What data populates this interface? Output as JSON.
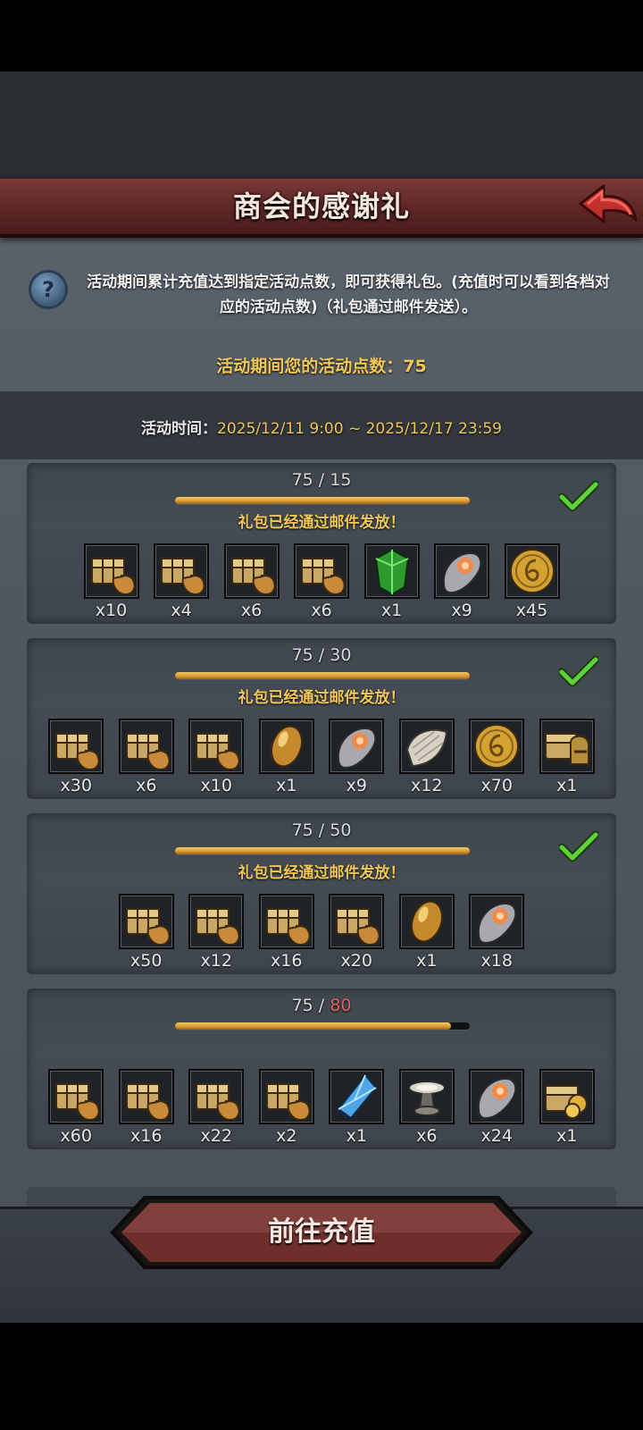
{
  "header": {
    "title": "商会的感谢礼"
  },
  "description": "活动期间累计充值达到指定活动点数，即可获得礼包。(充值时可以看到各档对应的活动点数)（礼包通过邮件发送）。",
  "points": {
    "text": "活动期间您的活动点数：75",
    "value": 75
  },
  "time": {
    "label": "活动时间：",
    "value": "2025/12/11 9:00 ~ 2025/12/17 23:59"
  },
  "tiers": [
    {
      "current": "75",
      "sep": " / ",
      "required": "15",
      "progress": 1.0,
      "claimed": true,
      "status": "礼包已经通过邮件发放！",
      "items": [
        {
          "icon": "chest-bag-icon",
          "qty": "x10"
        },
        {
          "icon": "chest-bag-icon",
          "qty": "x4"
        },
        {
          "icon": "chest-bag-icon",
          "qty": "x6"
        },
        {
          "icon": "chest-bag-icon",
          "qty": "x6"
        },
        {
          "icon": "green-crystal-icon",
          "qty": "x1"
        },
        {
          "icon": "stone-icon",
          "qty": "x9"
        },
        {
          "icon": "gold-coin-icon",
          "qty": "x45"
        }
      ]
    },
    {
      "current": "75",
      "sep": " / ",
      "required": "30",
      "progress": 1.0,
      "claimed": true,
      "status": "礼包已经通过邮件发放！",
      "items": [
        {
          "icon": "chest-bag-icon",
          "qty": "x30"
        },
        {
          "icon": "chest-bag-icon",
          "qty": "x6"
        },
        {
          "icon": "chest-bag-icon",
          "qty": "x10"
        },
        {
          "icon": "gold-egg-icon",
          "qty": "x1"
        },
        {
          "icon": "stone-icon",
          "qty": "x9"
        },
        {
          "icon": "fabric-icon",
          "qty": "x12"
        },
        {
          "icon": "gold-coin-icon",
          "qty": "x70"
        },
        {
          "icon": "chest-helmet-icon",
          "qty": "x1"
        }
      ]
    },
    {
      "current": "75",
      "sep": " / ",
      "required": "50",
      "progress": 1.0,
      "claimed": true,
      "status": "礼包已经通过邮件发放！",
      "items": [
        {
          "icon": "chest-bag-icon",
          "qty": "x50"
        },
        {
          "icon": "chest-bag-icon",
          "qty": "x12"
        },
        {
          "icon": "chest-bag-icon",
          "qty": "x16"
        },
        {
          "icon": "chest-bag-icon",
          "qty": "x20"
        },
        {
          "icon": "gold-egg-icon",
          "qty": "x1"
        },
        {
          "icon": "stone-icon",
          "qty": "x18"
        }
      ]
    },
    {
      "current": "75",
      "sep": " / ",
      "required": "80",
      "progress": 0.9375,
      "claimed": false,
      "status": "",
      "items": [
        {
          "icon": "chest-bag-icon",
          "qty": "x60"
        },
        {
          "icon": "chest-bag-icon",
          "qty": "x16"
        },
        {
          "icon": "chest-bag-icon",
          "qty": "x22"
        },
        {
          "icon": "chest-bag-icon",
          "qty": "x2"
        },
        {
          "icon": "blue-crystal-icon",
          "qty": "x1"
        },
        {
          "icon": "pedestal-icon",
          "qty": "x6"
        },
        {
          "icon": "stone-icon",
          "qty": "x24"
        },
        {
          "icon": "chest-gold-icon",
          "qty": "x1"
        }
      ]
    }
  ],
  "colors": {
    "accent_gold": "#f1c75a",
    "banner_red": "#5e2626",
    "check_green": "#5fd13a",
    "short_red": "#e06060"
  },
  "footer": {
    "button_label": "前往充值"
  }
}
